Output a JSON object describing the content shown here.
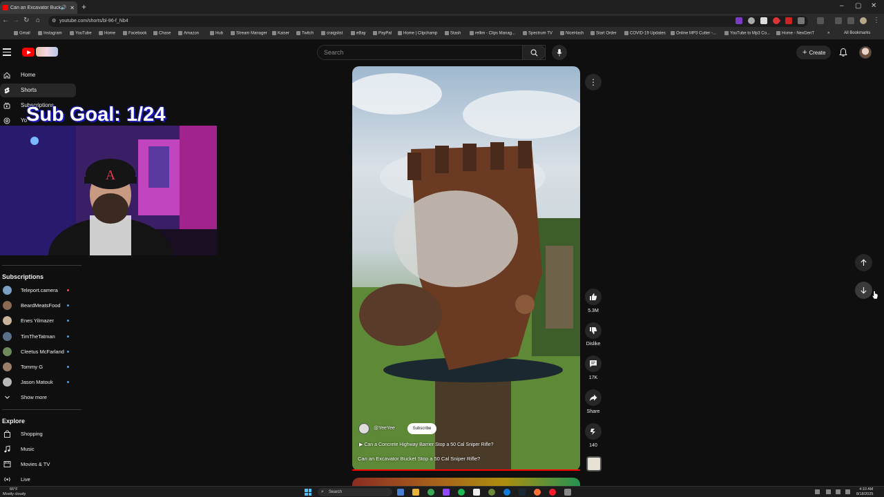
{
  "browser": {
    "tab_title": "Can an Excavator Bucket St",
    "url": "youtube.com/shorts/bl-96-f_Nb4",
    "all_bookmarks": "All Bookmarks",
    "bookmarks": [
      "Gmail",
      "Instagram",
      "YouTube",
      "Home",
      "Facebook",
      "Chase",
      "Amazon",
      "Hub",
      "Stream Manager",
      "Kaiser",
      "Twitch",
      "craigslist",
      "eBay",
      "PayPal",
      "Home | Clipchamp",
      "Stash",
      "rellim - Clips Manag...",
      "Spectrum TV",
      "NiceHash",
      "Start Order",
      "COVID-19 Updates",
      "Online MP3 Cutter -...",
      "YouTube to Mp3 Co...",
      "Home - NexGenT"
    ]
  },
  "masthead": {
    "search_placeholder": "Search",
    "create_label": "Create"
  },
  "sidebar": {
    "items": [
      {
        "label": "Home"
      },
      {
        "label": "Shorts"
      },
      {
        "label": "Subscriptions"
      },
      {
        "label": "Yo"
      }
    ],
    "subscriptions_title": "Subscriptions",
    "subscriptions": [
      {
        "name": "Teleport.camera",
        "color": "#7aa0c4"
      },
      {
        "name": "BeardMeatsFood",
        "color": "#8a6a55"
      },
      {
        "name": "Enes Yilmazer",
        "color": "#c9b39a"
      },
      {
        "name": "TimTheTatman",
        "color": "#5a6f8a"
      },
      {
        "name": "Cleetus McFarland",
        "color": "#6c8a5a"
      },
      {
        "name": "Tommy G",
        "color": "#9a7f6a"
      },
      {
        "name": "Jason Matouk",
        "color": "#b8b8b8"
      }
    ],
    "show_more": "Show more",
    "explore_title": "Explore",
    "explore": [
      {
        "label": "Shopping"
      },
      {
        "label": "Music"
      },
      {
        "label": "Movies & TV"
      },
      {
        "label": "Live"
      }
    ]
  },
  "overlay": {
    "sub_goal": "Sub Goal: 1/24"
  },
  "short": {
    "channel": "@YeeYee",
    "subscribe": "Subscribe",
    "related": "Can a Concrete Highway Barrier Stop a 50 Cal Sniper Rifle?",
    "title": "Can an Excavator Bucket Stop a 50 Cal Sniper Rifle?",
    "likes": "5.3M",
    "dislike": "Dislike",
    "comments": "17K",
    "share": "Share",
    "remix": "140"
  },
  "taskbar": {
    "temp": "66°F",
    "weather": "Mostly cloudy",
    "search": "Search",
    "time": "4:10 AM",
    "date": "8/18/2025"
  },
  "colors": {
    "accent": "#ff0000",
    "background": "#0f0f0f",
    "live_dot": "#3ea6ff"
  }
}
